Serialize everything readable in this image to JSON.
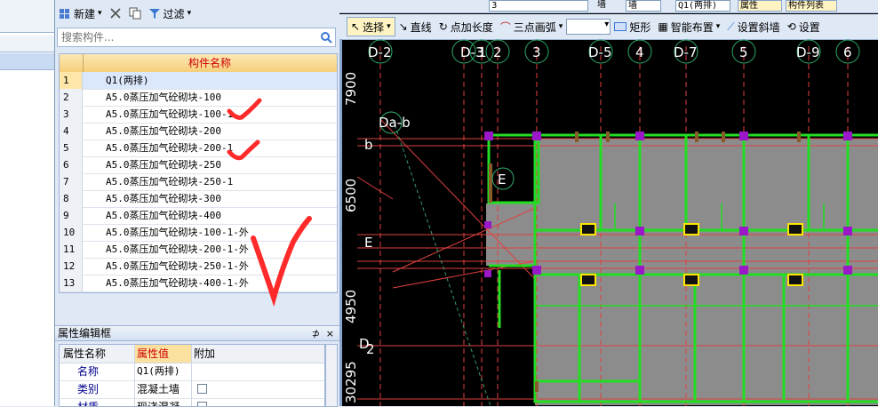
{
  "component_panel": {
    "toolbar": {
      "new_label": "新建",
      "filter_label": "过滤"
    },
    "search": {
      "placeholder": "搜索构件..."
    },
    "grid": {
      "header": "构件名称",
      "rows": [
        {
          "num": "1",
          "name": "Q1(两排)"
        },
        {
          "num": "2",
          "name": "A5.0蒸压加气砼砌块-100"
        },
        {
          "num": "3",
          "name": "A5.0蒸压加气砼砌块-100-1"
        },
        {
          "num": "4",
          "name": "A5.0蒸压加气砼砌块-200"
        },
        {
          "num": "5",
          "name": "A5.0蒸压加气砼砌块-200-1"
        },
        {
          "num": "6",
          "name": "A5.0蒸压加气砼砌块-250"
        },
        {
          "num": "7",
          "name": "A5.0蒸压加气砼砌块-250-1"
        },
        {
          "num": "8",
          "name": "A5.0蒸压加气砼砌块-300"
        },
        {
          "num": "9",
          "name": "A5.0蒸压加气砼砌块-400"
        },
        {
          "num": "10",
          "name": "A5.0蒸压加气砼砌块-100-1-外"
        },
        {
          "num": "11",
          "name": "A5.0蒸压加气砼砌块-200-1-外"
        },
        {
          "num": "12",
          "name": "A5.0蒸压加气砼砌块-250-1-外"
        },
        {
          "num": "13",
          "name": "A5.0蒸压加气砼砌块-400-1-外"
        }
      ]
    }
  },
  "property_panel": {
    "title": "属性编辑框",
    "pin": "⊅",
    "close": "×",
    "headers": {
      "name": "属性名称",
      "value": "属性值",
      "extra": "附加"
    },
    "rows": [
      {
        "name": "名称",
        "value": "Q1(两排)"
      },
      {
        "name": "类别",
        "value": "混凝土墙"
      },
      {
        "name": "材质",
        "value": "现浇混凝"
      }
    ]
  },
  "drawing_toolbar": {
    "top_tabs": [
      "属性",
      "构件列表"
    ],
    "layer_value": "3",
    "type1": "墙",
    "type2": "墙",
    "component_value": "Q1(两排)",
    "select_label": "选择",
    "line_label": "直线",
    "point_length_label": "点加长度",
    "arc_label": "三点画弧",
    "rect_label": "矩形",
    "smart_label": "智能布置",
    "slope_label": "设置斜墙",
    "set_label": "设置"
  },
  "drawing": {
    "axis_labels_top": [
      "D-2",
      "D-3",
      "1",
      "2",
      "3",
      "D-5",
      "4",
      "D-7",
      "5",
      "D-9",
      "6"
    ],
    "dims_left": [
      "7900",
      "6500",
      "4950",
      "30295"
    ],
    "labels_left": [
      "b",
      "E",
      "D",
      "2"
    ],
    "annotations": [
      "Da-b",
      "E"
    ]
  }
}
